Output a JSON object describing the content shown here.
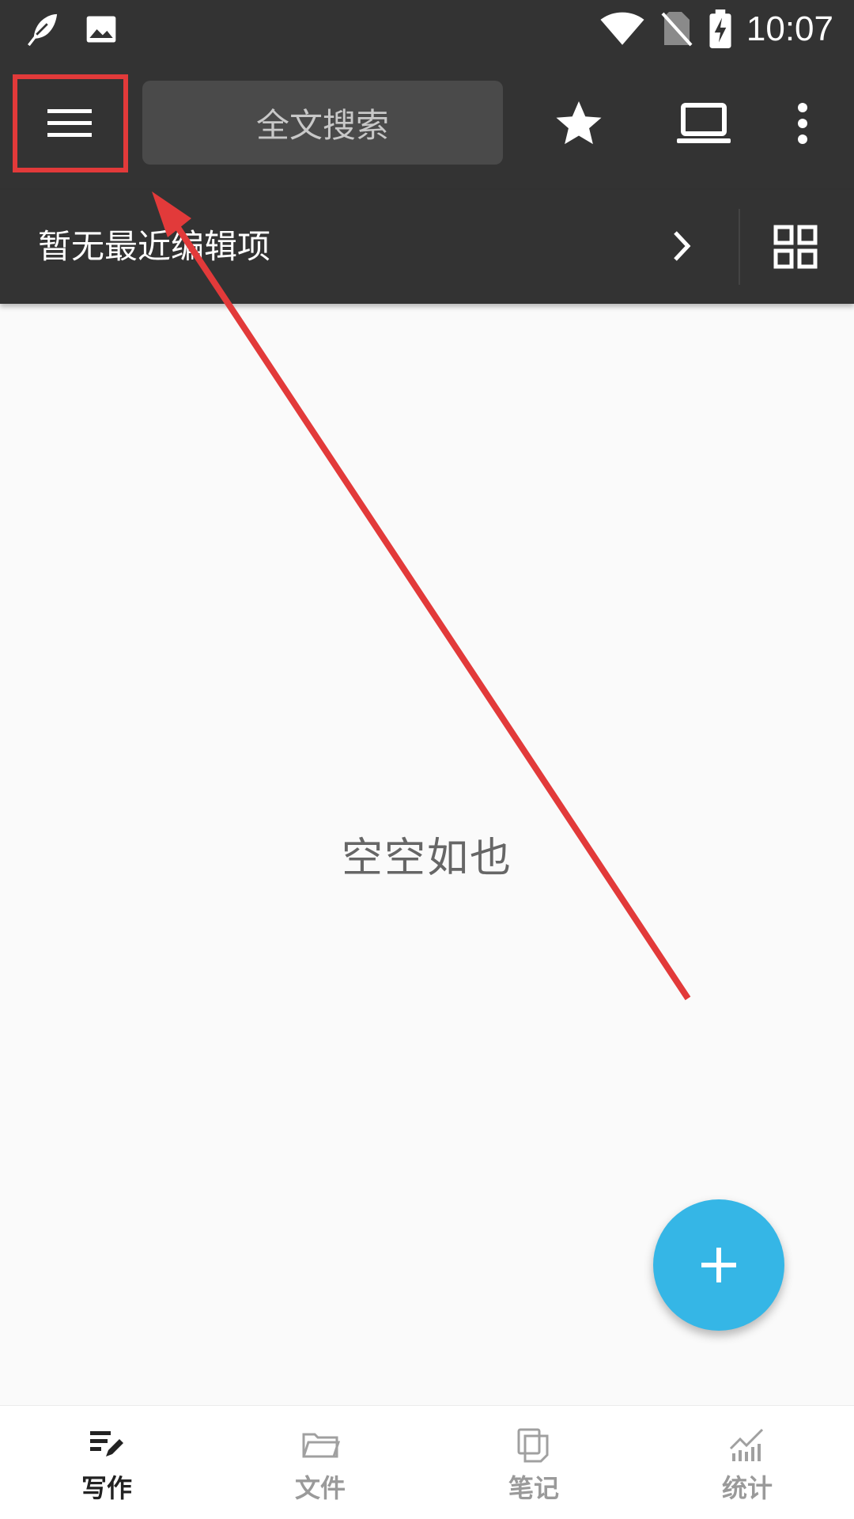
{
  "status_bar": {
    "time": "10:07",
    "icons": [
      "feather-icon",
      "image-icon",
      "wifi-icon",
      "no-sim-icon",
      "battery-charging-icon"
    ]
  },
  "app_bar": {
    "menu_icon": "hamburger-menu-icon",
    "search_label": "全文搜索",
    "actions": [
      "star-icon",
      "laptop-icon",
      "more-vertical-icon"
    ]
  },
  "recent": {
    "text": "暂无最近编辑项",
    "chevron_icon": "chevron-right-icon",
    "grid_icon": "grid-icon"
  },
  "main": {
    "empty_text": "空空如也"
  },
  "fab": {
    "icon": "plus-icon",
    "color": "#35b6e6"
  },
  "bottom_nav": {
    "items": [
      {
        "label": "写作",
        "icon": "write-icon",
        "active": true
      },
      {
        "label": "文件",
        "icon": "folder-icon",
        "active": false
      },
      {
        "label": "笔记",
        "icon": "notes-icon",
        "active": false
      },
      {
        "label": "统计",
        "icon": "stats-icon",
        "active": false
      }
    ]
  },
  "colors": {
    "toolbar": "#333333",
    "annotation": "#e23a3a",
    "background": "#fafafa"
  }
}
